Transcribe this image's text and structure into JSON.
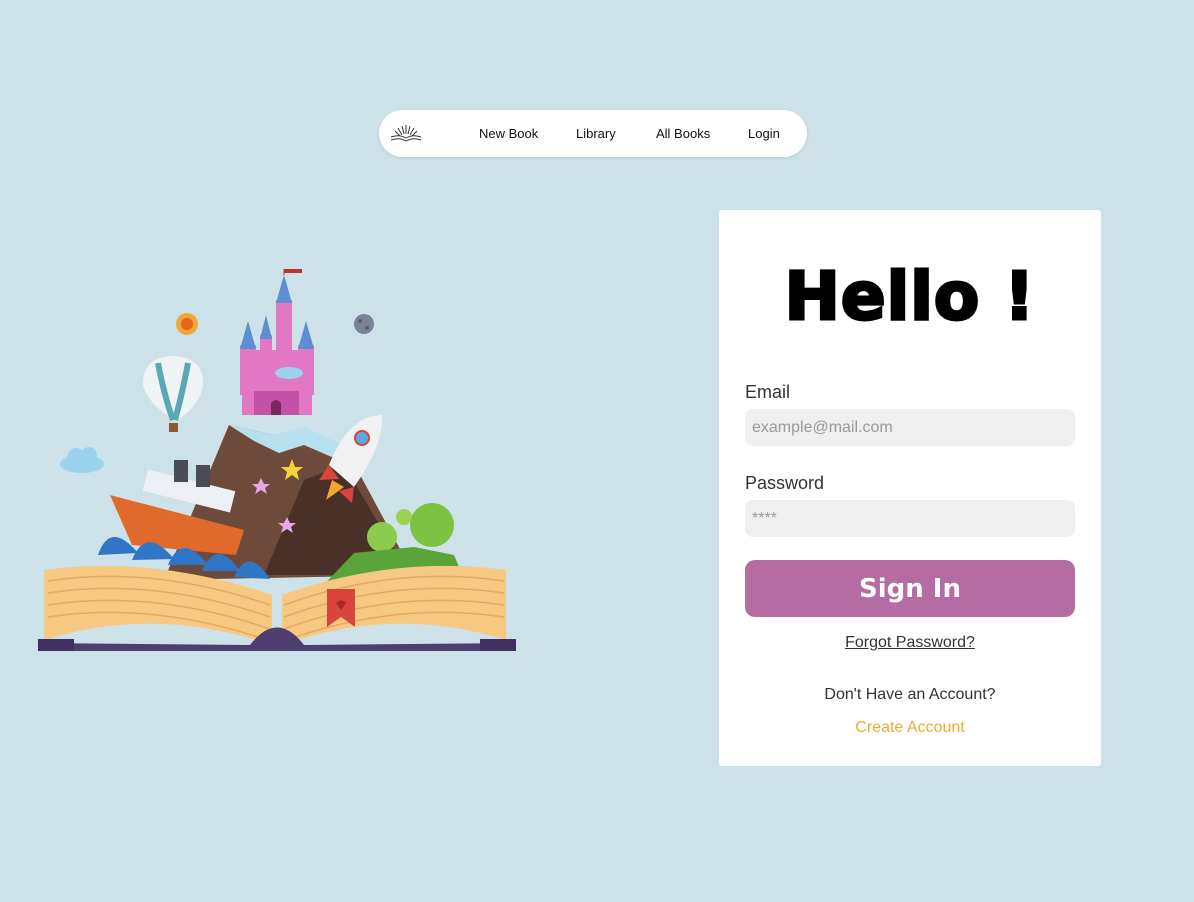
{
  "nav": {
    "items": [
      {
        "label": "New Book"
      },
      {
        "label": "Library"
      },
      {
        "label": "All Books"
      },
      {
        "label": "Login"
      }
    ]
  },
  "login_card": {
    "heading": "Hello !",
    "email_label": "Email",
    "email_placeholder": "example@mail.com",
    "password_label": "Password",
    "password_placeholder": "****",
    "sign_in_label": "Sign In",
    "forgot_password_label": "Forgot Password?",
    "no_account_text": "Don't Have an Account?",
    "create_account_label": "Create Account"
  },
  "colors": {
    "page_background": "#cde1e8",
    "sign_in_button": "#b46ca2",
    "create_account_link": "#f0a930"
  }
}
